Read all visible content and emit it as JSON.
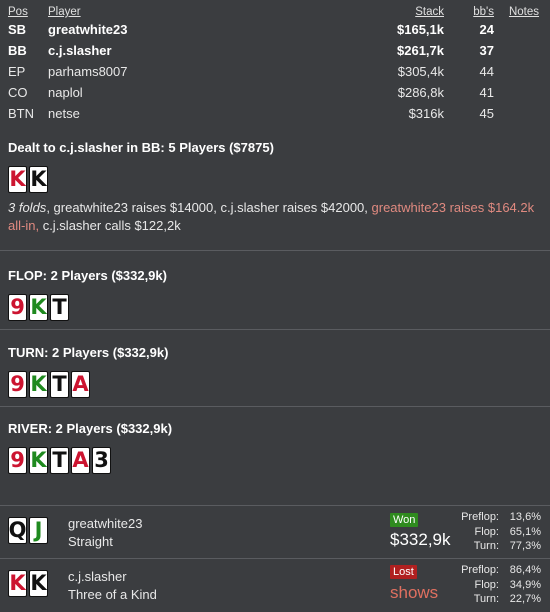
{
  "table": {
    "headers": {
      "pos": "Pos",
      "player": "Player",
      "stack": "Stack",
      "bbs": "bb's",
      "notes": "Notes"
    },
    "rows": [
      {
        "pos": "SB",
        "player": "greatwhite23",
        "stack": "$165,1k",
        "bbs": "24",
        "bold": true
      },
      {
        "pos": "BB",
        "player": "c.j.slasher",
        "stack": "$261,7k",
        "bbs": "37",
        "bold": true
      },
      {
        "pos": "EP",
        "player": "parhams8007",
        "stack": "$305,4k",
        "bbs": "44",
        "bold": false
      },
      {
        "pos": "CO",
        "player": "naplol",
        "stack": "$286,8k",
        "bbs": "41",
        "bold": false
      },
      {
        "pos": "BTN",
        "player": "netse",
        "stack": "$316k",
        "bbs": "45",
        "bold": false
      }
    ]
  },
  "preflop": {
    "title": "Dealt to c.j.slasher in BB: 5 Players ($7875)",
    "cards": [
      {
        "rank": "K",
        "suit": "diamonds"
      },
      {
        "rank": "K",
        "suit": "spades"
      }
    ],
    "action": {
      "folds": "3 folds",
      "part1": ", greatwhite23 raises $14000, c.j.slasher raises $42000, ",
      "allin": "greatwhite23 raises $164.2k all-in,",
      "part2": " c.j.slasher calls $122,2k"
    }
  },
  "flop": {
    "title": "FLOP: 2 Players ($332,9k)",
    "cards": [
      {
        "rank": "9",
        "suit": "diamonds"
      },
      {
        "rank": "K",
        "suit": "clubs"
      },
      {
        "rank": "T",
        "suit": "spades"
      }
    ]
  },
  "turn": {
    "title": "TURN: 2 Players ($332,9k)",
    "cards": [
      {
        "rank": "9",
        "suit": "diamonds"
      },
      {
        "rank": "K",
        "suit": "clubs"
      },
      {
        "rank": "T",
        "suit": "spades"
      },
      {
        "rank": "A",
        "suit": "diamonds"
      }
    ]
  },
  "river": {
    "title": "RIVER: 2 Players ($332,9k)",
    "cards": [
      {
        "rank": "9",
        "suit": "diamonds"
      },
      {
        "rank": "K",
        "suit": "clubs"
      },
      {
        "rank": "T",
        "suit": "spades"
      },
      {
        "rank": "A",
        "suit": "diamonds"
      },
      {
        "rank": "3",
        "suit": "spades"
      }
    ]
  },
  "results": [
    {
      "player": "greatwhite23",
      "hand": "Straight",
      "status": "Won",
      "amount": "$332,9k",
      "cards": [
        {
          "rank": "Q",
          "suit": "spades"
        },
        {
          "rank": "J",
          "suit": "clubs"
        }
      ],
      "stats": [
        {
          "label": "Preflop:",
          "value": "13,6%"
        },
        {
          "label": "Flop:",
          "value": "65,1%"
        },
        {
          "label": "Turn:",
          "value": "77,3%"
        }
      ]
    },
    {
      "player": "c.j.slasher",
      "hand": "Three of a Kind",
      "status": "Lost",
      "amount": "shows",
      "cards": [
        {
          "rank": "K",
          "suit": "diamonds"
        },
        {
          "rank": "K",
          "suit": "spades"
        }
      ],
      "stats": [
        {
          "label": "Preflop:",
          "value": "86,4%"
        },
        {
          "label": "Flop:",
          "value": "34,9%"
        },
        {
          "label": "Turn:",
          "value": "22,7%"
        }
      ]
    }
  ],
  "colors": {
    "background": "#3b3d40",
    "won": "#2f8b1f",
    "lost": "#b02020",
    "allin_text": "#e08a80",
    "diamonds": "#cc1430",
    "clubs": "#1f8a1f",
    "spades": "#111111"
  }
}
